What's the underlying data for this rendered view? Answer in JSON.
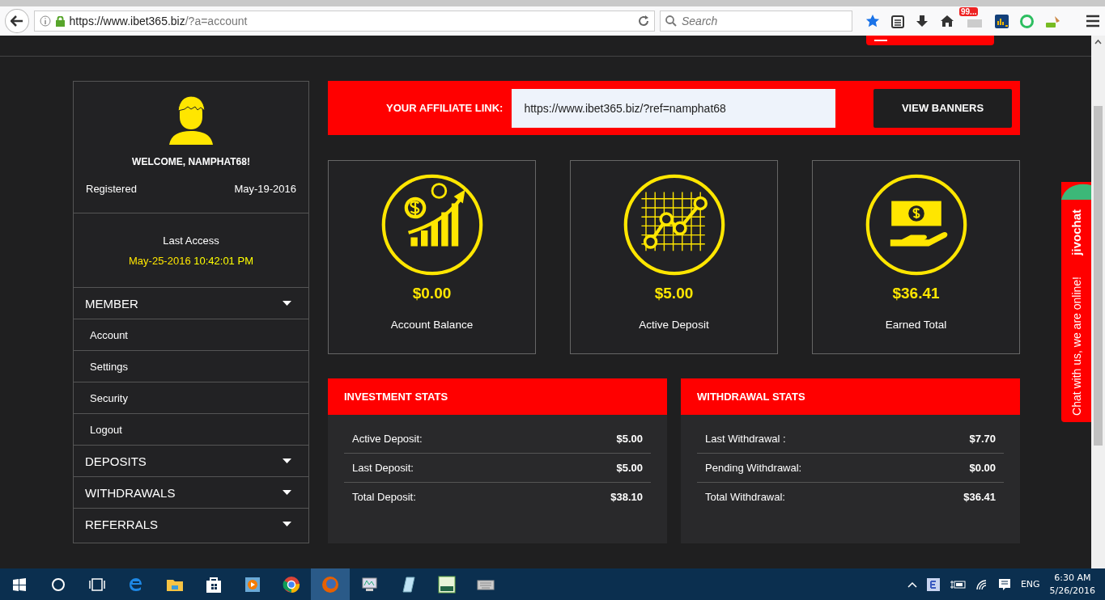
{
  "browser": {
    "url_host": "https://www.ibet365.biz",
    "url_path": "/?a=account",
    "search_placeholder": "Search",
    "badge": "99..."
  },
  "profile": {
    "welcome": "WELCOME, NAMPHAT68!",
    "registered_label": "Registered",
    "registered_date": "May-19-2016",
    "last_access_label": "Last Access",
    "last_access_date": "May-25-2016",
    "last_access_time": "10:42:01 PM"
  },
  "menu": [
    {
      "label": "MEMBER",
      "children": [
        {
          "label": "Account"
        },
        {
          "label": "Settings"
        },
        {
          "label": "Security"
        },
        {
          "label": "Logout"
        }
      ]
    },
    {
      "label": "DEPOSITS"
    },
    {
      "label": "WITHDRAWALS"
    },
    {
      "label": "REFERRALS"
    }
  ],
  "affiliate": {
    "label": "YOUR AFFILIATE LINK:",
    "link": "https://www.ibet365.biz/?ref=namphat68",
    "button": "VIEW BANNERS"
  },
  "cards": [
    {
      "kind": "growth",
      "amount": "$0.00",
      "label": "Account Balance"
    },
    {
      "kind": "chart",
      "amount": "$5.00",
      "label": "Active Deposit"
    },
    {
      "kind": "cash",
      "amount": "$36.41",
      "label": "Earned Total"
    }
  ],
  "stats": [
    {
      "title": "INVESTMENT STATS",
      "rows": [
        {
          "label": "Active Deposit:",
          "value": "$5.00"
        },
        {
          "label": "Last Deposit:",
          "value": "$5.00"
        },
        {
          "label": "Total Deposit:",
          "value": "$38.10"
        }
      ]
    },
    {
      "title": "WITHDRAWAL STATS",
      "rows": [
        {
          "label": "Last Withdrawal :",
          "value": "$7.70"
        },
        {
          "label": "Pending Withdrawal:",
          "value": "$0.00"
        },
        {
          "label": "Total Withdrawal:",
          "value": "$36.41"
        }
      ]
    }
  ],
  "chat": {
    "brand": "jivochat",
    "message": "Chat with us, we are online!"
  },
  "taskbar": {
    "language": "ENG",
    "time": "6:30 AM",
    "date": "5/26/2016"
  }
}
